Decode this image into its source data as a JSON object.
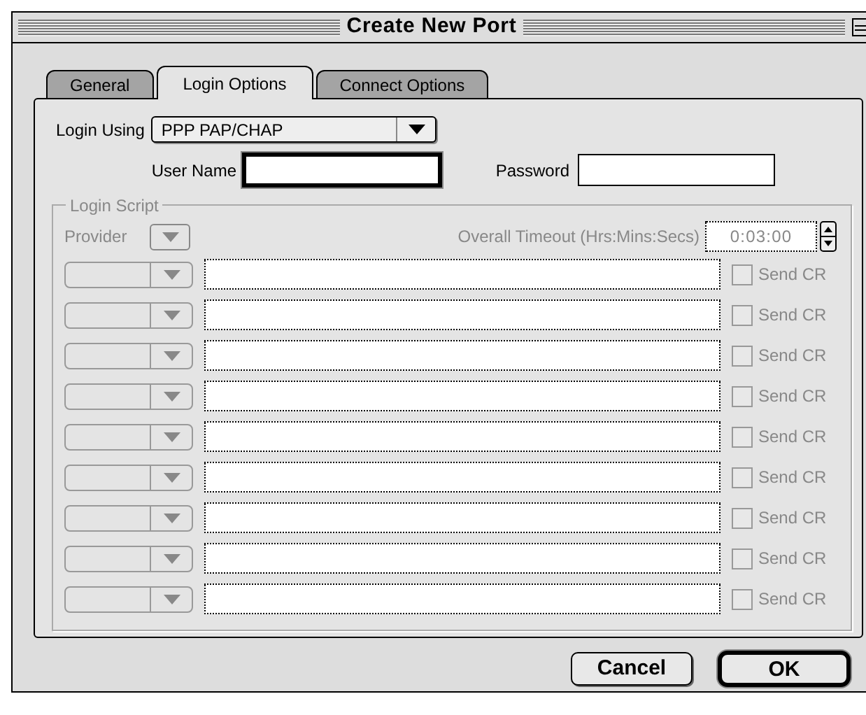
{
  "window": {
    "title": "Create New Port"
  },
  "tabs": [
    {
      "label": "General",
      "selected": false
    },
    {
      "label": "Login Options",
      "selected": true
    },
    {
      "label": "Connect Options",
      "selected": false
    }
  ],
  "login_using": {
    "label": "Login Using",
    "value": "PPP PAP/CHAP"
  },
  "user_name": {
    "label": "User Name",
    "focused": true
  },
  "password": {
    "label": "Password",
    "focused": false
  },
  "login_script": {
    "title": "Login Script",
    "disabled": true,
    "provider_label": "Provider",
    "timeout_label": "Overall Timeout (Hrs:Mins:Secs)",
    "timeout_value": "0:03:00",
    "rows": [
      {
        "checked": false,
        "label": "Send CR"
      },
      {
        "checked": false,
        "label": "Send CR"
      },
      {
        "checked": false,
        "label": "Send CR"
      },
      {
        "checked": false,
        "label": "Send CR"
      },
      {
        "checked": false,
        "label": "Send CR"
      },
      {
        "checked": false,
        "label": "Send CR"
      },
      {
        "checked": false,
        "label": "Send CR"
      },
      {
        "checked": false,
        "label": "Send CR"
      },
      {
        "checked": false,
        "label": "Send CR"
      }
    ]
  },
  "buttons": [
    {
      "label": "Cancel",
      "default": false
    },
    {
      "label": "OK",
      "default": true
    }
  ]
}
